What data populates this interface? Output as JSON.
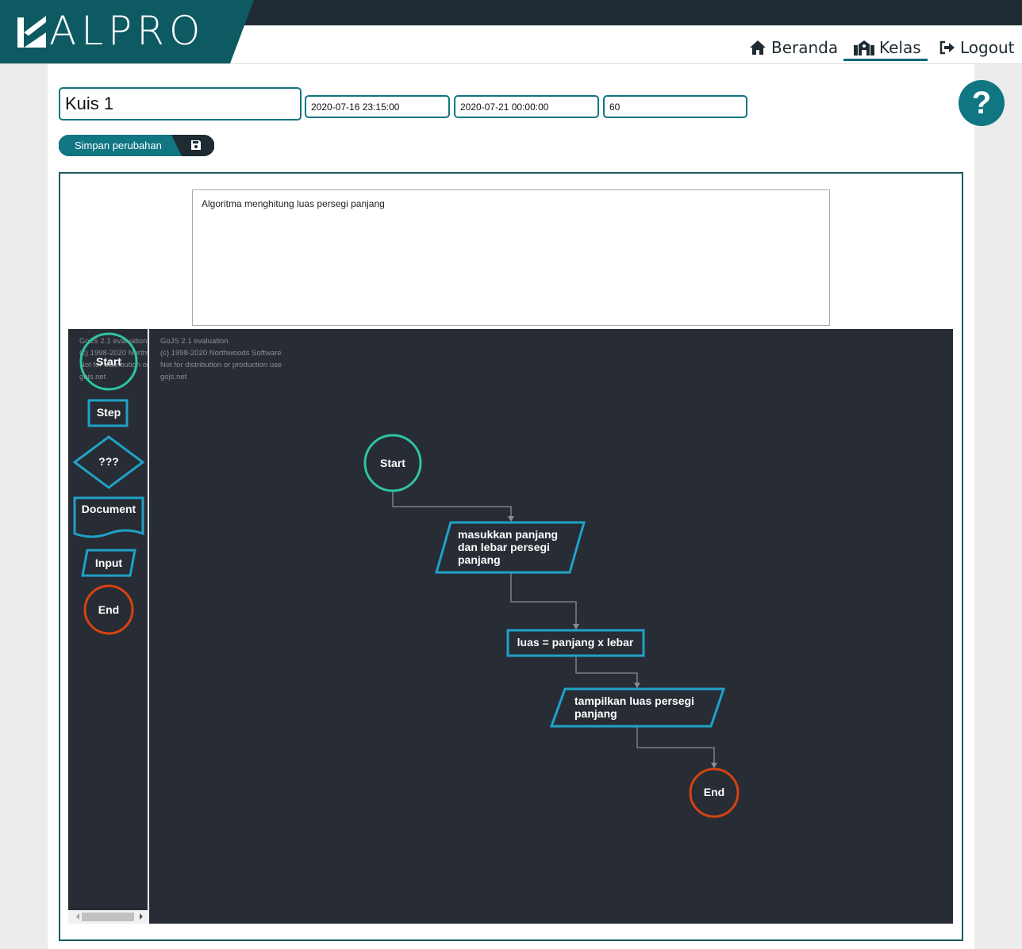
{
  "header": {
    "logo_text": "ALPRO",
    "nav": [
      {
        "label": "Beranda",
        "icon": "home-icon"
      },
      {
        "label": "Kelas",
        "icon": "school-icon",
        "active": true
      },
      {
        "label": "Logout",
        "icon": "logout-icon"
      }
    ]
  },
  "quiz": {
    "title_value": "Kuis 1",
    "start_value": "2020-07-16 23:15:00",
    "end_value": "2020-07-21 00:00:00",
    "duration_value": "60",
    "save_label": "Simpan perubahan",
    "save_icon": "floppy-disk-icon",
    "help_icon": "question-icon"
  },
  "description": "Algoritma menghitung luas persegi panjang",
  "watermark": {
    "line1": "GoJS 2.1 evaluation",
    "line2": "(c) 1998-2020 Northwoods Software",
    "line3": "Not for distribution or production use",
    "line4": "gojs.net"
  },
  "palette": {
    "start": "Start",
    "step": "Step",
    "decision": "???",
    "document": "Document",
    "input": "Input",
    "end": "End"
  },
  "flowchart": {
    "start": "Start",
    "input_line1": "masukkan panjang",
    "input_line2": "dan lebar persegi",
    "input_line3": "panjang",
    "process": "luas = panjang x lebar",
    "output_line1": "tampilkan luas persegi",
    "output_line2": "panjang",
    "end": "End"
  },
  "colors": {
    "brand_dark": "#1f2b32",
    "brand_teal": "#0e5a63",
    "accent": "#107682",
    "start_stroke": "#2ec4a4",
    "step_stroke": "#1fa2c8",
    "end_stroke": "#d54312",
    "canvas_bg": "#282c34"
  }
}
